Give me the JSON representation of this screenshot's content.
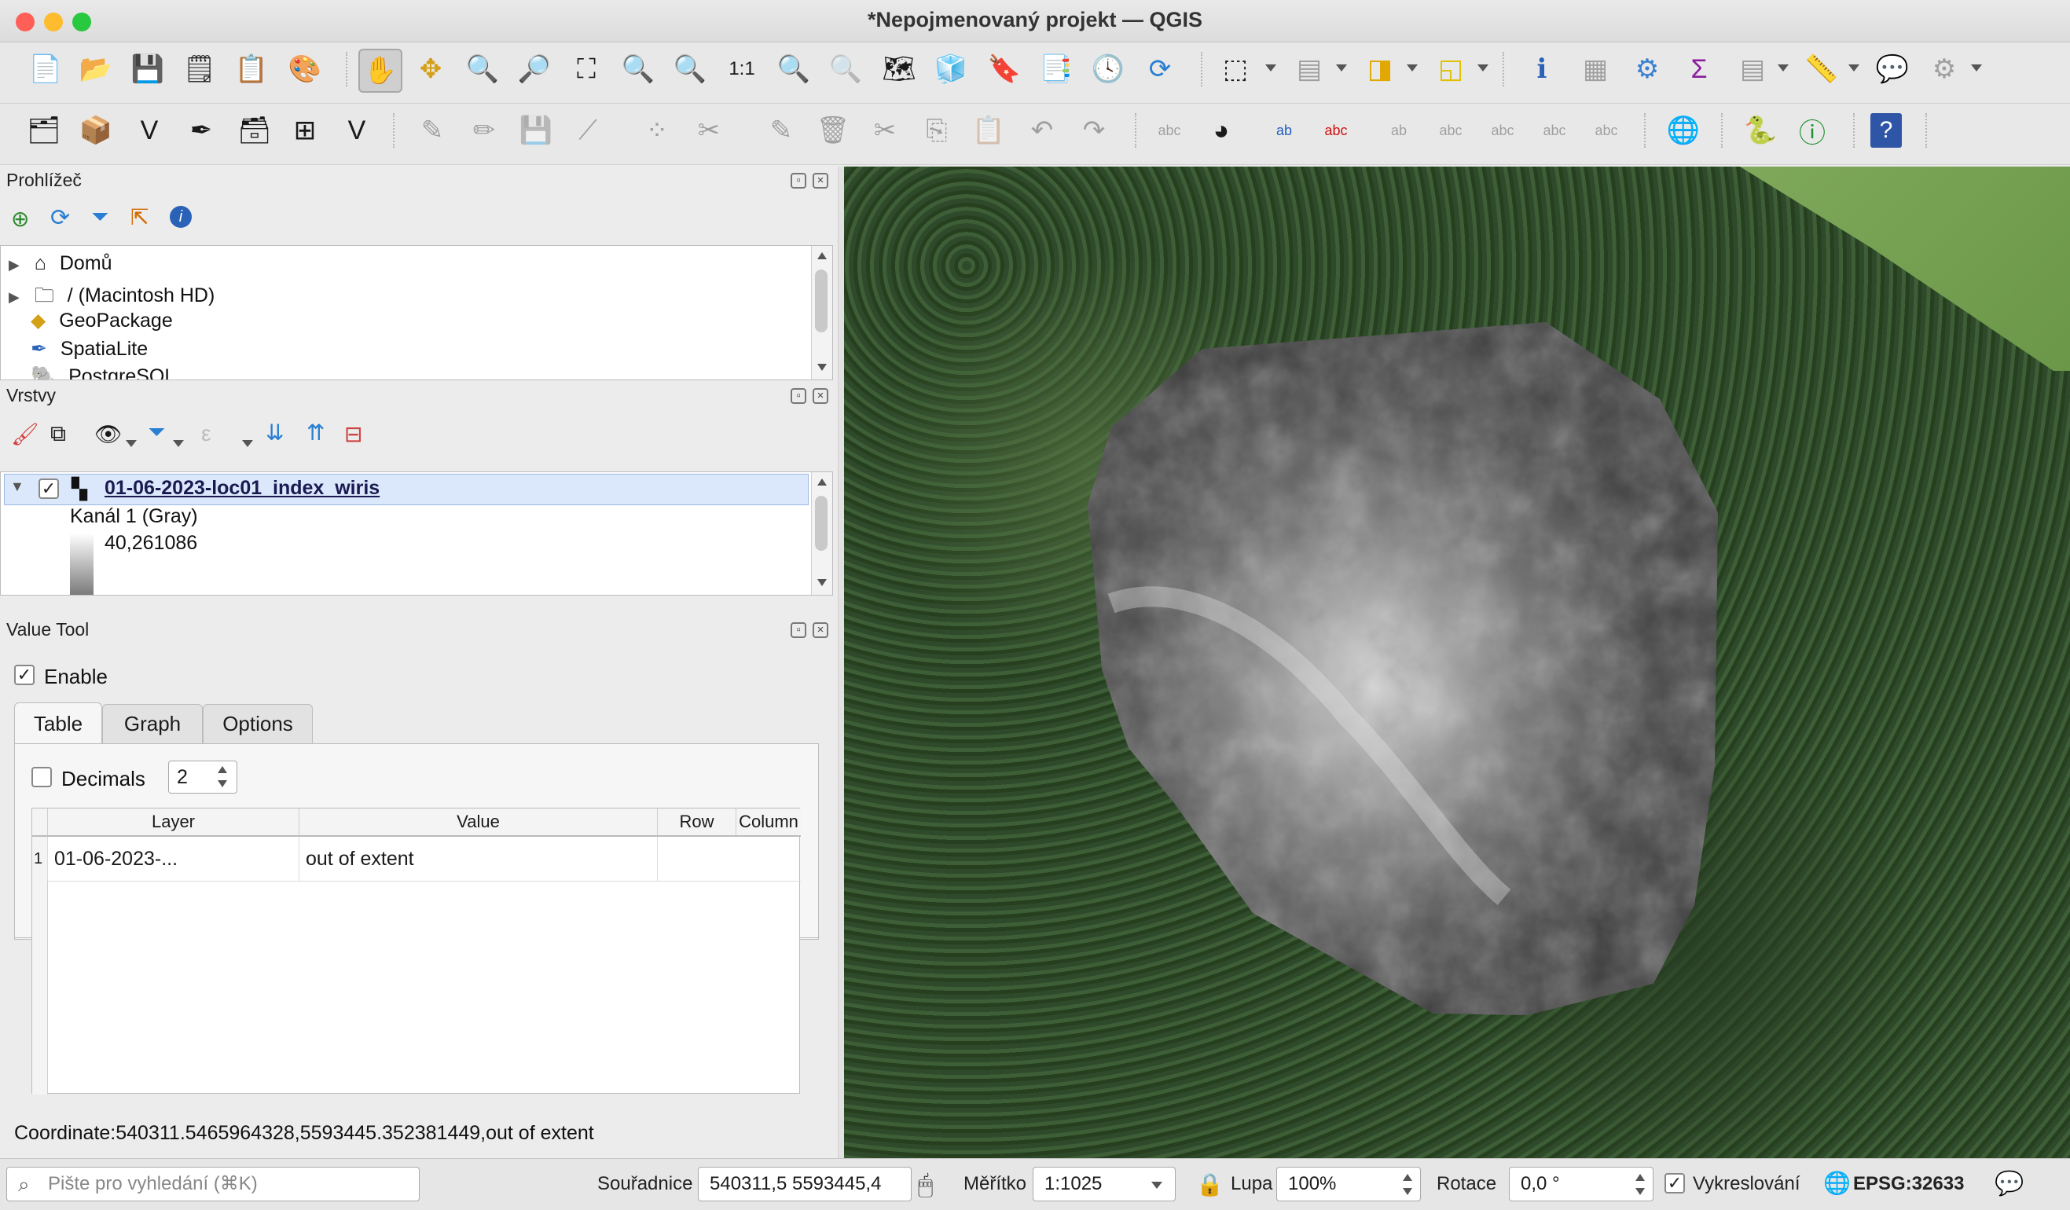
{
  "window": {
    "title": "*Nepojmenovaný projekt — QGIS"
  },
  "toolbar1": {
    "icons": [
      "new-project-icon",
      "open-project-icon",
      "save-project-icon",
      "new-print-layout-icon",
      "layout-manager-icon",
      "style-manager-icon",
      "pan-hand-icon",
      "pan-to-selection-icon",
      "zoom-in-icon",
      "zoom-out-icon",
      "zoom-full-icon",
      "zoom-to-selection-icon",
      "zoom-to-layer-icon",
      "zoom-native-icon",
      "zoom-last-icon",
      "zoom-next-icon",
      "new-map-view-icon",
      "new-3d-view-icon",
      "new-bookmark-icon",
      "show-bookmarks-icon",
      "temporal-controller-icon",
      "refresh-icon",
      "select-features-icon",
      "attribute-table-select-icon",
      "deselect-icon",
      "select-by-location-icon",
      "identify-icon",
      "open-attribute-table-icon",
      "processing-toolbox-icon",
      "statistics-sum-icon",
      "field-calculator-icon",
      "measure-icon",
      "map-tips-icon",
      "settings-gear-icon"
    ]
  },
  "toolbar2": {
    "icons": [
      "data-source-manager-icon",
      "new-geopackage-layer-icon",
      "new-shapefile-layer-icon",
      "new-spatialite-layer-icon",
      "new-temporary-layer-icon",
      "new-virtual-layer-icon",
      "new-mesh-layer-icon",
      "digitize-icon",
      "edit-pencil-icon",
      "save-edits-icon",
      "add-line-icon",
      "vertex-tool-icon",
      "node-tool-icon",
      "modify-attributes-icon",
      "delete-selected-icon",
      "cut-icon",
      "copy-icon",
      "paste-icon",
      "undo-icon",
      "redo-icon",
      "label-icon",
      "diagram-icon",
      "label-pin-icon",
      "label-highlight-icon",
      "move-label-icon",
      "show-hide-label-icon",
      "rotate-label-icon",
      "change-label-icon",
      "label-properties-icon",
      "globe-binoculars-icon",
      "python-icon",
      "value-tool-icon",
      "help-icon"
    ]
  },
  "browser": {
    "title": "Prohlížeč",
    "items": [
      {
        "label": "Domů",
        "icon": "home-icon",
        "expandable": true
      },
      {
        "label": "/ (Macintosh HD)",
        "icon": "folder-icon",
        "expandable": true
      },
      {
        "label": "GeoPackage",
        "icon": "geopackage-icon",
        "expandable": false
      },
      {
        "label": "SpatiaLite",
        "icon": "spatialite-icon",
        "expandable": false
      },
      {
        "label": "PostgreSQL",
        "icon": "postgresql-icon",
        "expandable": false
      }
    ]
  },
  "layers": {
    "title": "Vrstvy",
    "layer_name": "01-06-2023-loc01_index_wiris",
    "band_label": "Kanál 1 (Gray)",
    "max_value": "40,261086"
  },
  "value_tool": {
    "title": "Value Tool",
    "enable_label": "Enable",
    "tabs": [
      "Table",
      "Graph",
      "Options"
    ],
    "decimals_label": "Decimals",
    "decimals_value": "2",
    "columns": [
      "Layer",
      "Value",
      "Row",
      "Column"
    ],
    "rows": [
      {
        "index": "1",
        "layer": "01-06-2023-...",
        "value": "out of extent",
        "row": "",
        "column": ""
      }
    ],
    "coordinate_text": "Coordinate:540311.5465964328,5593445.352381449,out of extent"
  },
  "status": {
    "search_placeholder": "Pište pro vyhledání (⌘K)",
    "coord_label": "Souřadnice",
    "coord_value": "540311,5  5593445,4",
    "scale_label": "Měřítko",
    "scale_value": "1:1025",
    "magnifier_label": "Lupa",
    "magnifier_value": "100%",
    "rotation_label": "Rotace",
    "rotation_value": "0,0 °",
    "render_label": "Vykreslování",
    "crs": "EPSG:32633"
  },
  "colors": {
    "accent": "#1f5fbf",
    "selection": "#dbe8fb",
    "map_forest": "#34502f",
    "field": "#7fa85a"
  }
}
